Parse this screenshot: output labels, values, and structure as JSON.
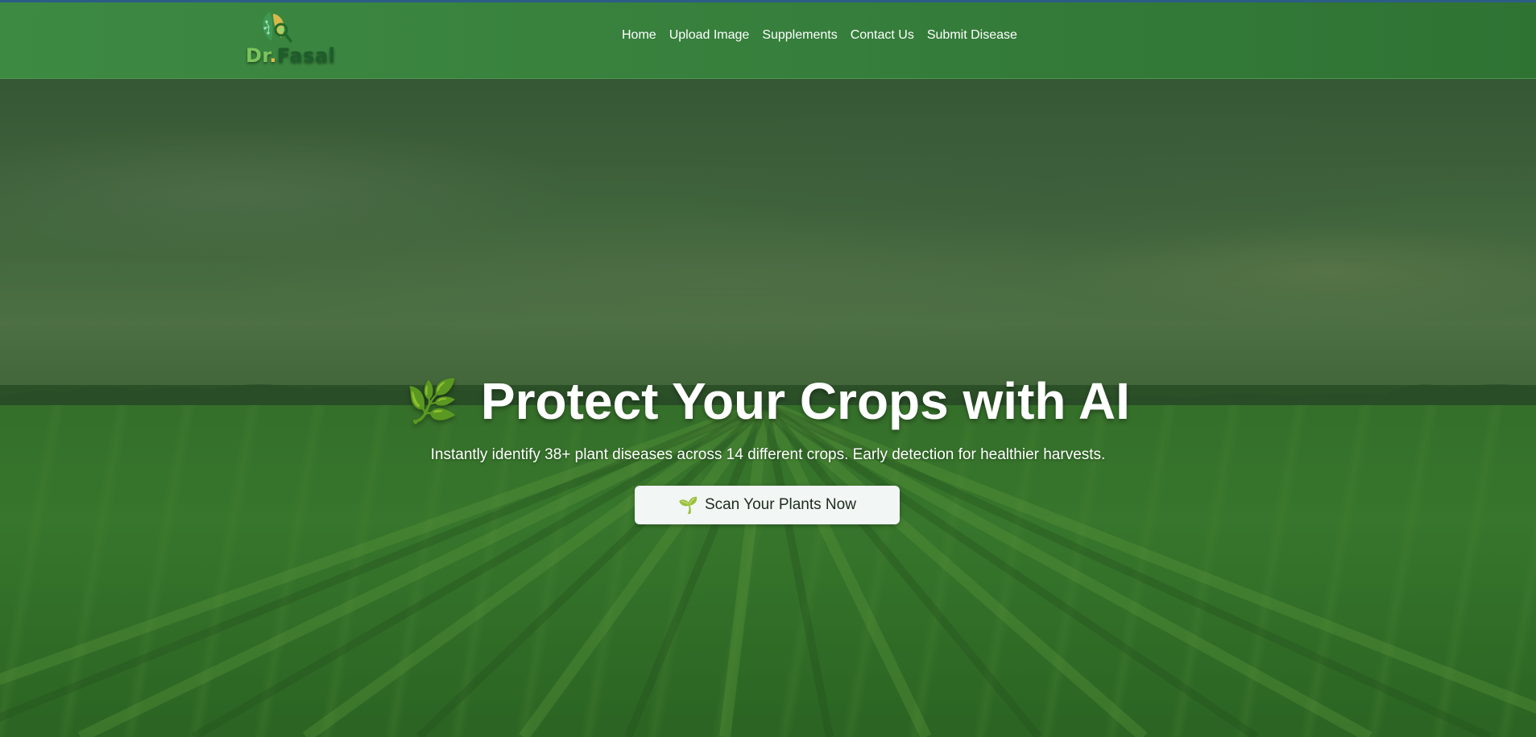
{
  "brand": {
    "logo_text_dr": "Dr",
    "logo_text_dot": ".",
    "logo_text_fasal": "Fasal",
    "colors": {
      "navbar": "#3a8540",
      "dr": "#7cc35b",
      "fasal": "#1d5d2a",
      "dot": "#e6b949"
    }
  },
  "nav": {
    "items": [
      {
        "label": "Home"
      },
      {
        "label": "Upload Image"
      },
      {
        "label": "Supplements"
      },
      {
        "label": "Contact Us"
      },
      {
        "label": "Submit Disease"
      }
    ]
  },
  "hero": {
    "emoji": "🌿",
    "title": "Protect Your Crops with AI",
    "subtitle": "Instantly identify 38+ plant diseases across 14 different crops. Early detection for healthier harvests.",
    "cta": {
      "icon": "🌱",
      "label": "Scan Your Plants Now"
    }
  }
}
